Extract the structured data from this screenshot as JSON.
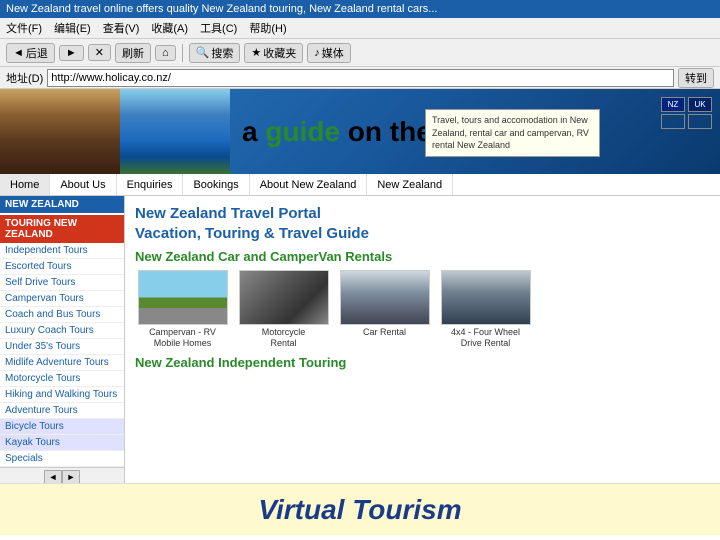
{
  "titlebar": {
    "text": "New Zealand travel online offers quality New Zealand touring, New Zealand rental cars..."
  },
  "menubar": {
    "items": [
      "文件(F)",
      "编辑(E)",
      "查看(V)",
      "收藏(A)",
      "工具(C)",
      "帮助(H)"
    ]
  },
  "toolbar": {
    "back_label": "后退",
    "forward_label": "→",
    "stop_label": "✕",
    "refresh_label": "刷新",
    "home_label": "⌂",
    "search_label": "搜索",
    "favorites_label": "收藏夹",
    "media_label": "媒体",
    "address_label": "地址(D)",
    "address_value": "http://www.holicay.co.nz/",
    "go_label": "转到"
  },
  "hero": {
    "prefix_text": "a ",
    "green_text": "guide",
    "suffix_text": " on the web"
  },
  "nav": {
    "items": [
      "Home",
      "About Us",
      "Enquiries",
      "Bookings",
      "About New Zealand",
      "New Zealand"
    ]
  },
  "sidebar": {
    "section_title": "NEW ZEALAND",
    "touring_title": "TOURING NEW ZEALAND",
    "items": [
      "Independent Tours",
      "Escorted Tours",
      "Self Drive Tours",
      "Campervan Tours",
      "Coach and Bus Tours",
      "Luxury Coach Tours",
      "Under 35's Tours",
      "Midlife Adventure Tours",
      "Motorcycle Tours",
      "Hiking and Walking Tours",
      "Adventure Tours",
      "Bicycle Tours",
      "Kayak Tours",
      "Specials"
    ]
  },
  "main": {
    "portal_title_line1": "New Zealand Travel Portal",
    "portal_title_line2": "Vacation, Touring & Travel Guide",
    "car_rentals_title": "New Zealand Car and CamperVan Rentals",
    "independent_touring_title": "New Zealand Independent Touring",
    "rental_items": [
      {
        "label": "Campervan - RV\nMobile Homes"
      },
      {
        "label": "Motorcycle\nRental"
      },
      {
        "label": "Car Rental"
      },
      {
        "label": "4x4 - Four Wheel\nDrive Rental"
      }
    ]
  },
  "tooltip": {
    "text": "Travel,  tours and accomodation in New Zealand, rental car and campervan, RV rental New Zealand"
  },
  "footer": {
    "virtual_tourism_text": "Virtual Tourism"
  },
  "flags": {
    "nz_label": "NZ",
    "uk_label": "UK"
  }
}
